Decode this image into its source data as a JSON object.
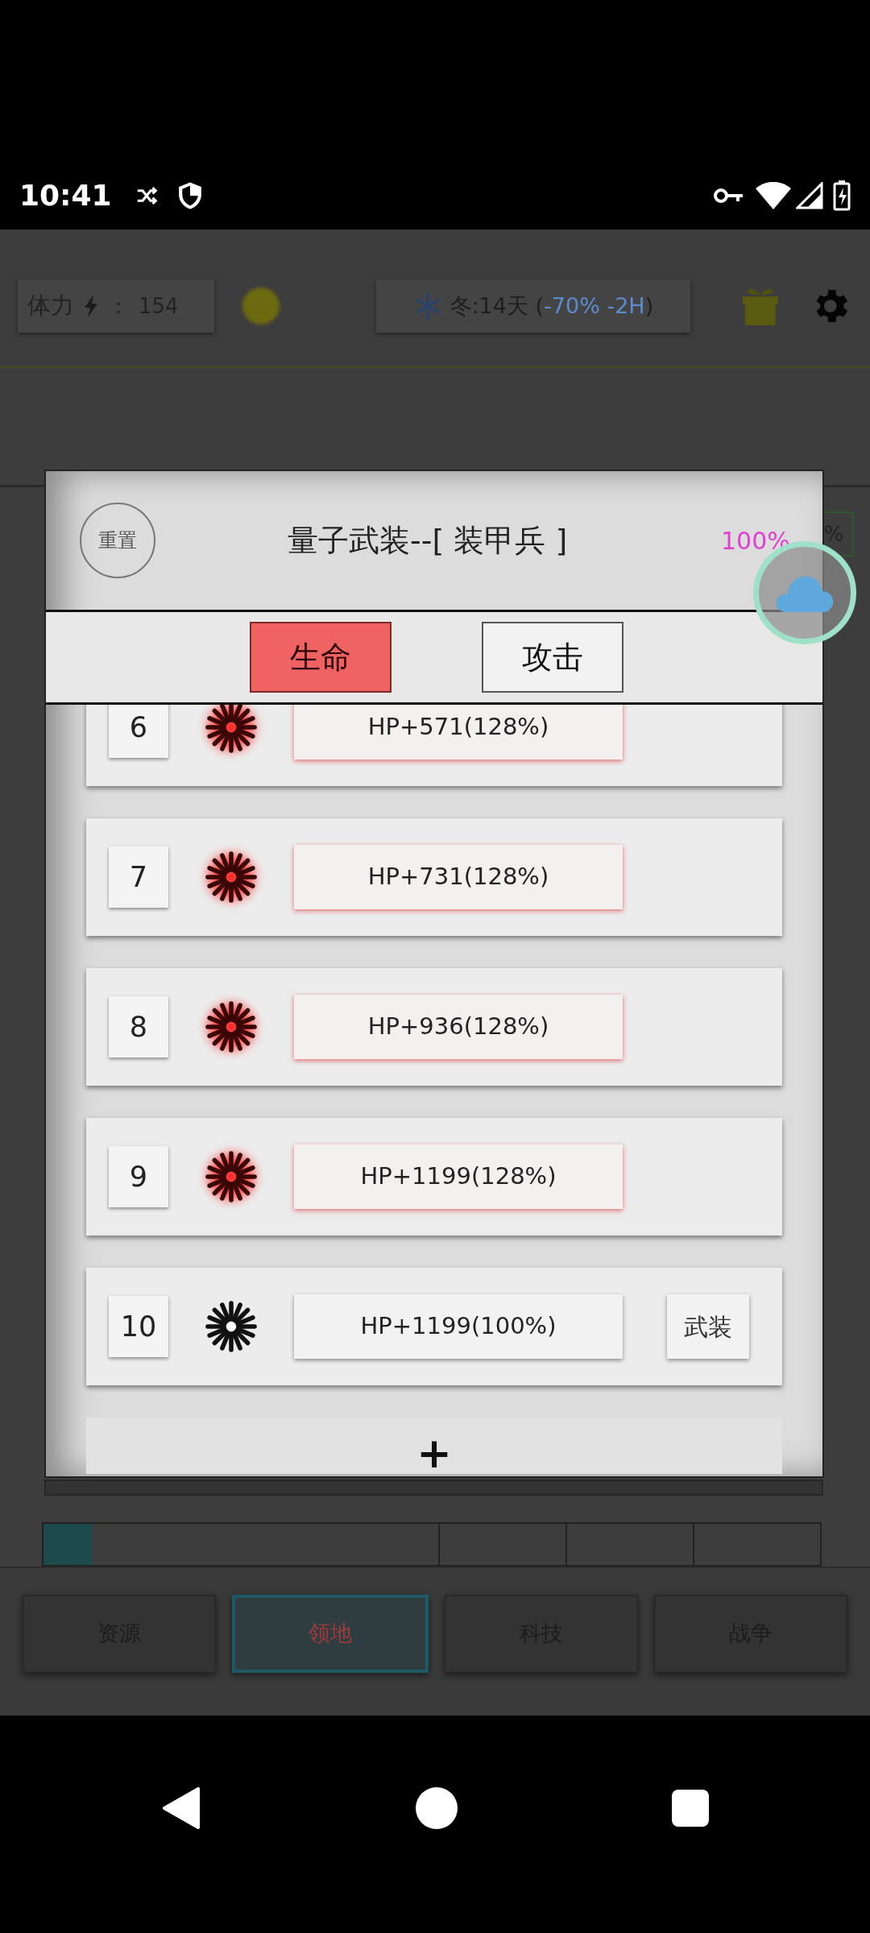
{
  "status_bar": {
    "time": "10:41"
  },
  "header": {
    "stamina_label": "体力",
    "stamina_separator": "：",
    "stamina_value": "154",
    "season": "冬:14天 (",
    "season_effect": "-70% -2H",
    "season_end": ")"
  },
  "background_fragment": "%",
  "dialog": {
    "reset": "重置",
    "title": "量子武装--[ 装甲兵 ]",
    "percent": "100%",
    "tabs": [
      {
        "label": "生命",
        "selected": true
      },
      {
        "label": "攻击",
        "selected": false
      }
    ],
    "rows": [
      {
        "number": "6",
        "boosted": true,
        "stat": "HP+571(128%)"
      },
      {
        "number": "7",
        "boosted": true,
        "stat": "HP+731(128%)"
      },
      {
        "number": "8",
        "boosted": true,
        "stat": "HP+936(128%)"
      },
      {
        "number": "9",
        "boosted": true,
        "stat": "HP+1199(128%)"
      },
      {
        "number": "10",
        "boosted": false,
        "stat": "HP+1199(100%)",
        "action": "武装"
      }
    ],
    "add": "+"
  },
  "nav": [
    {
      "label": "资源",
      "selected": false
    },
    {
      "label": "领地",
      "selected": true
    },
    {
      "label": "科技",
      "selected": false
    },
    {
      "label": "战争",
      "selected": false
    }
  ]
}
